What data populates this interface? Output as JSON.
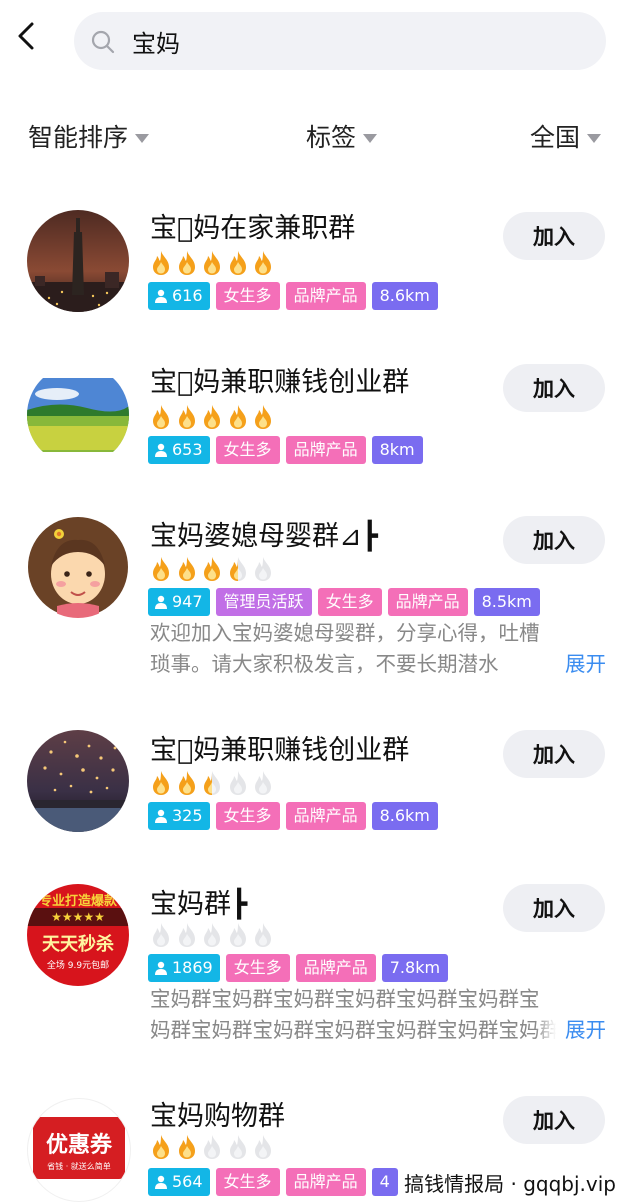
{
  "search": {
    "query": "宝妈"
  },
  "filters": [
    {
      "label": "智能排序"
    },
    {
      "label": "标签"
    },
    {
      "label": "全国"
    }
  ],
  "join_label": "加入",
  "groups": [
    {
      "title": "宝􏿽妈在家兼职群",
      "rating": 5,
      "members": "616",
      "tags": [
        "女生多",
        "品牌产品"
      ],
      "distance": "8.6km"
    },
    {
      "title": "宝􏿽妈兼职赚钱创业群",
      "rating": 5,
      "members": "653",
      "tags": [
        "女生多",
        "品牌产品"
      ],
      "distance": "8km"
    },
    {
      "title": "宝妈婆媳母婴群⊿┣",
      "rating": 3.5,
      "members": "947",
      "tags": [
        "管理员活跃",
        "女生多",
        "品牌产品"
      ],
      "distance": "8.5km",
      "desc": [
        "欢迎加入宝妈婆媳母婴群，分享心得，吐槽",
        "琐事。请大家积极发言，不要长期潜水"
      ],
      "more": "展开"
    },
    {
      "title": "宝􏿽妈兼职赚钱创业群",
      "rating": 2.5,
      "members": "325",
      "tags": [
        "女生多",
        "品牌产品"
      ],
      "distance": "8.6km"
    },
    {
      "title": "宝妈群┣",
      "rating": 0,
      "members": "1869",
      "tags": [
        "女生多",
        "品牌产品"
      ],
      "distance": "7.8km",
      "desc": [
        "宝妈群宝妈群宝妈群宝妈群宝妈群宝妈群宝",
        "妈群宝妈群宝妈群宝妈群宝妈群宝妈群宝妈群"
      ],
      "more": "展开"
    },
    {
      "title": "宝妈购物群",
      "rating": 2,
      "members": "564",
      "tags": [
        "女生多",
        "品牌产品"
      ],
      "distance": "4"
    }
  ],
  "avatar_text": {
    "g5": [
      "专业打造爆款",
      "★★★★★",
      "天天秒杀",
      "全场 9.9元包邮"
    ],
    "g6": [
      "优惠券",
      "省钱 · 就送么简单"
    ]
  },
  "watermark": "搞钱情报局 · gqqbj.vip",
  "colors": {
    "member_tag": "#13b6e6",
    "pink_tag": "#f46fb8",
    "purple_tag": "#7a6cf0",
    "violet_tag": "#c16fe6",
    "link": "#3a8cf0",
    "flame": "#f5a01a"
  }
}
